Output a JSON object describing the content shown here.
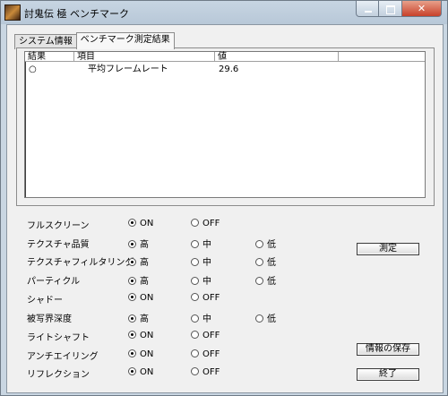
{
  "window": {
    "title": "討鬼伝 極 ベンチマーク"
  },
  "tabs": [
    {
      "label": "システム情報",
      "active": false
    },
    {
      "label": "ベンチマーク測定結果",
      "active": true
    }
  ],
  "results": {
    "columns": [
      "結果",
      "項目",
      "値",
      ""
    ],
    "rows": [
      {
        "result": "○",
        "item": "平均フレームレート",
        "value": "29.6"
      }
    ]
  },
  "settings": [
    {
      "label": "フルスクリーン",
      "options": [
        "ON",
        "OFF"
      ],
      "selected": 0
    },
    {
      "label": "テクスチャ品質",
      "options": [
        "高",
        "中",
        "低"
      ],
      "selected": 0
    },
    {
      "label": "テクスチャフィルタリング",
      "options": [
        "高",
        "中",
        "低"
      ],
      "selected": 0
    },
    {
      "label": "パーティクル",
      "options": [
        "高",
        "中",
        "低"
      ],
      "selected": 0
    },
    {
      "label": "シャドー",
      "options": [
        "ON",
        "OFF"
      ],
      "selected": 0
    },
    {
      "label": "被写界深度",
      "options": [
        "高",
        "中",
        "低"
      ],
      "selected": 0
    },
    {
      "label": "ライトシャフト",
      "options": [
        "ON",
        "OFF"
      ],
      "selected": 0
    },
    {
      "label": "アンチエイリング",
      "options": [
        "ON",
        "OFF"
      ],
      "selected": 0
    },
    {
      "label": "リフレクション",
      "options": [
        "ON",
        "OFF"
      ],
      "selected": 0
    }
  ],
  "buttons": {
    "measure": "測定",
    "save_info": "情報の保存",
    "exit": "終了"
  }
}
